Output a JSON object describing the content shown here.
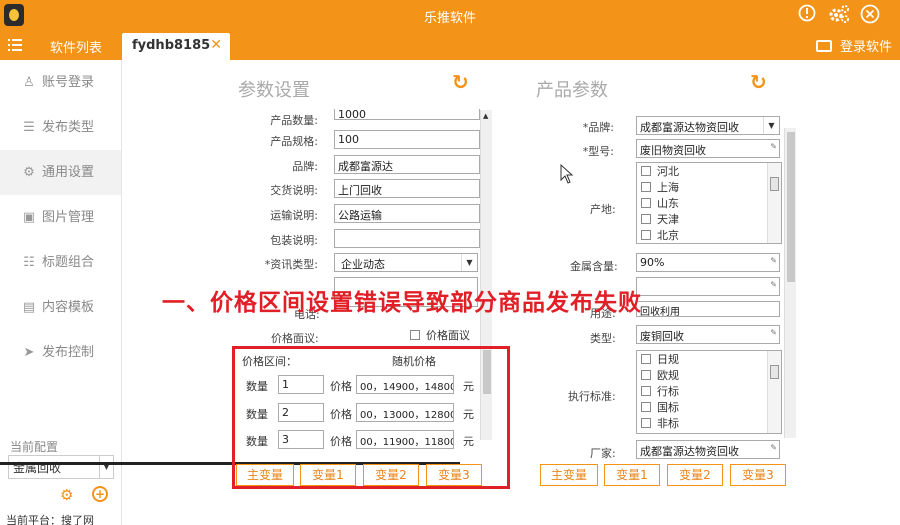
{
  "titlebar": {
    "title": "乐推软件",
    "info_icon": "info-icon",
    "settings_icon": "gear-icon",
    "close_icon": "close-icon"
  },
  "tabbar": {
    "menu_icon": "menu-icon",
    "software_list_label": "软件列表",
    "active_tab_label": "fydhb8185",
    "login_label": "登录软件"
  },
  "sidebar": {
    "items": [
      {
        "label": "账号登录",
        "icon": "user-icon"
      },
      {
        "label": "发布类型",
        "icon": "list-icon"
      },
      {
        "label": "通用设置",
        "icon": "settings-icon"
      },
      {
        "label": "图片管理",
        "icon": "image-icon"
      },
      {
        "label": "标题组合",
        "icon": "list-icon"
      },
      {
        "label": "内容模板",
        "icon": "template-icon"
      },
      {
        "label": "发布控制",
        "icon": "send-icon"
      }
    ],
    "config_label": "当前配置",
    "config_value": "金属回收",
    "platform_text": "当前平台：搜了网"
  },
  "param_panel": {
    "title": "参数设置",
    "rows": [
      {
        "label": "产品数量:",
        "value": "1000"
      },
      {
        "label": "产品规格:",
        "value": "100"
      },
      {
        "label": "品牌:",
        "value": "成都富源达"
      },
      {
        "label": "交货说明:",
        "value": "上门回收"
      },
      {
        "label": "运输说明:",
        "value": "公路运输"
      },
      {
        "label": "包装说明:",
        "value": ""
      },
      {
        "label": "*资讯类型:",
        "value": "企业动态"
      }
    ],
    "phone_label": "电话:",
    "price_negotiable_label": "价格面议:",
    "price_negotiable_check": "价格面议",
    "price_range_label": "价格区间：",
    "random_price_label": "随机价格",
    "price_rows": [
      {
        "qty_label": "数量",
        "qty": "1",
        "price_label": "价格",
        "prices": "00，14900，14800",
        "unit": "元"
      },
      {
        "qty_label": "数量",
        "qty": "2",
        "price_label": "价格",
        "prices": "00，13000，12800",
        "unit": "元"
      },
      {
        "qty_label": "数量",
        "qty": "3",
        "price_label": "价格",
        "prices": "00，11900，11800",
        "unit": "元"
      }
    ],
    "buttons": [
      "主变量",
      "变量1",
      "变量2",
      "变量3"
    ]
  },
  "product_panel": {
    "title": "产品参数",
    "brand_label": "*品牌:",
    "brand_value": "成都富源达物资回收",
    "model_label": "*型号:",
    "model_value": "废旧物资回收",
    "origin_label": "产地:",
    "origin_options": [
      "河北",
      "上海",
      "山东",
      "天津",
      "北京"
    ],
    "metal_label": "金属含量:",
    "metal_value": "90%",
    "use_label": "用途:",
    "use_value": "回收利用",
    "type_label": "类型:",
    "type_value": "废铜回收",
    "standard_label": "执行标准:",
    "standard_options": [
      "日规",
      "欧规",
      "行标",
      "国标",
      "非标"
    ],
    "maker_label": "厂家:",
    "maker_value": "成都富源达物资回收",
    "buttons": [
      "主变量",
      "变量1",
      "变量2",
      "变量3"
    ]
  },
  "overlay_caption": "一、价格区间设置错误导致部分商品发布失败",
  "colors": {
    "accent": "#f39317",
    "highlight_red": "#e01f26"
  }
}
